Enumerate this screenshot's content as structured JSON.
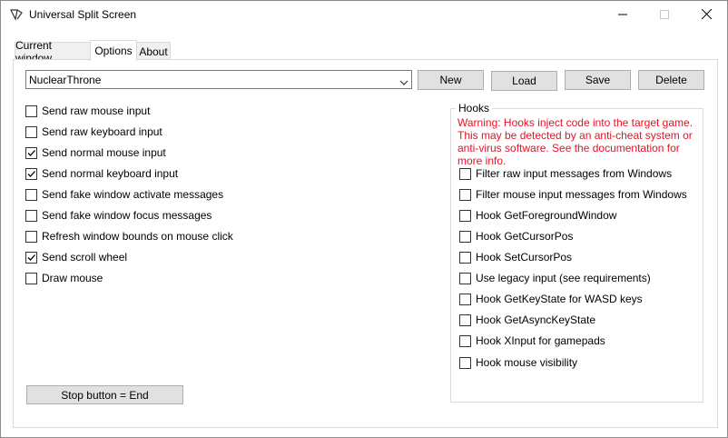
{
  "window": {
    "title": "Universal Split Screen",
    "icon": "split-screen-app-icon",
    "controls": [
      "minimize",
      "maximize",
      "close"
    ]
  },
  "tabs": [
    {
      "label": "Current window",
      "active": false
    },
    {
      "label": "Options",
      "active": true
    },
    {
      "label": "About",
      "active": false
    }
  ],
  "profile": {
    "selected": "NuclearThrone",
    "buttons": {
      "new": "New",
      "load": "Load",
      "save": "Save",
      "delete": "Delete"
    }
  },
  "left_options": [
    {
      "label": "Send raw mouse input",
      "checked": false
    },
    {
      "label": "Send raw keyboard input",
      "checked": false
    },
    {
      "label": "Send normal mouse input",
      "checked": true
    },
    {
      "label": "Send normal keyboard input",
      "checked": true
    },
    {
      "label": "Send fake window activate messages",
      "checked": false
    },
    {
      "label": "Send fake window focus messages",
      "checked": false
    },
    {
      "label": "Refresh window bounds on mouse click",
      "checked": false
    },
    {
      "label": "Send scroll wheel",
      "checked": true
    },
    {
      "label": "Draw mouse",
      "checked": false
    }
  ],
  "hooks": {
    "title": "Hooks",
    "warning": "Warning: Hooks inject code into the target game. This may be detected by an anti-cheat system or anti-virus software. See the documentation for more info.",
    "warning_color": "#e81123",
    "items": [
      {
        "label": "Filter raw input messages from Windows",
        "checked": false
      },
      {
        "label": "Filter mouse input messages from Windows",
        "checked": false
      },
      {
        "label": "Hook GetForegroundWindow",
        "checked": false
      },
      {
        "label": "Hook GetCursorPos",
        "checked": false
      },
      {
        "label": "Hook SetCursorPos",
        "checked": false
      },
      {
        "label": "Use legacy input (see requirements)",
        "checked": false
      },
      {
        "label": "Hook GetKeyState for WASD keys",
        "checked": false
      },
      {
        "label": "Hook GetAsyncKeyState",
        "checked": false
      },
      {
        "label": "Hook XInput for gamepads",
        "checked": false
      },
      {
        "label": "Hook mouse visibility",
        "checked": false
      }
    ]
  },
  "stop_button": "Stop button = End"
}
